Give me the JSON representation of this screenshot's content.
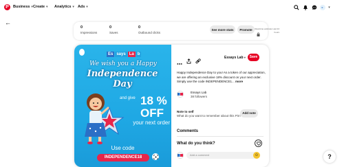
{
  "nav": {
    "business": "Business",
    "create": "Create",
    "analytics": "Analytics",
    "ads": "Ads",
    "profile_label": "E"
  },
  "stats": {
    "impressions_value": "0",
    "impressions_label": "Impressions",
    "saves_value": "0",
    "saves_label": "Saves",
    "outbound_value": "0",
    "outbound_label": "Outbound clicks",
    "realtime_note": "Real-time estimate Last 24 hours",
    "see_more": "See more stats",
    "promote": "Promote"
  },
  "pin_image": {
    "brand_parts": [
      "Es",
      "says",
      "La",
      "b"
    ],
    "wish": "We wish you a Happy",
    "headline": "Independence Day",
    "and_give": "and give",
    "percent": "18 %",
    "off": "OFF",
    "your_next_order": "your next order",
    "use_code": "Use code",
    "code": "INDEPENDENCE18"
  },
  "details": {
    "board": "Essays Lab",
    "save": "Save",
    "description": "Happy Independence Day to you! As a token of our appreciation, we are offering an exclusive 18% discount on your next order. Simply use the code INDEPENDENCE1...",
    "more": "more",
    "author_name": "Essays Lab",
    "author_followers": "38 followers",
    "note_title": "Note to self",
    "note_question": "What do you want to remember about this Pin?",
    "add_note": "Add note",
    "comments": "Comments",
    "what_think": "What do you think?",
    "comment_placeholder": "Add a comment"
  },
  "help": "?",
  "colors": {
    "brand_red": "#e60023",
    "pin_blue": "#1fa8e4"
  }
}
